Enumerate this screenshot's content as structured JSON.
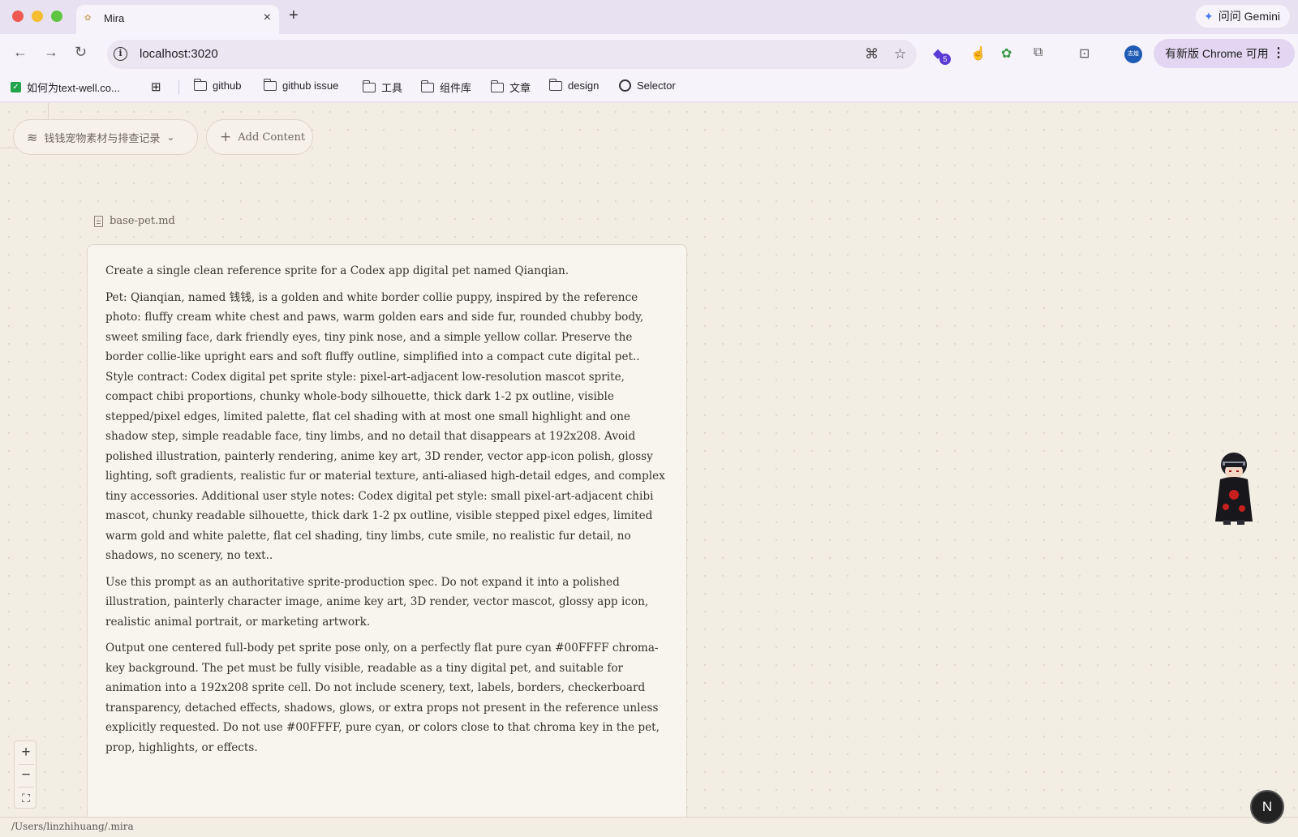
{
  "browser": {
    "tab": {
      "title": "Mira"
    },
    "gemini_label": "问问 Gemini",
    "url": "localhost:3020",
    "update_label": "有新版 Chrome 可用",
    "avatar_text": "志煌",
    "extension_badge": "5"
  },
  "bookmarks": [
    {
      "label": "如何为text-well.co..."
    },
    {
      "label": "github"
    },
    {
      "label": "github issue"
    },
    {
      "label": "工具"
    },
    {
      "label": "组件库"
    },
    {
      "label": "文章"
    },
    {
      "label": "design"
    },
    {
      "label": "Selector"
    }
  ],
  "canvas": {
    "workspace_label": "钱钱宠物素材与排查记录",
    "add_content_label": "Add Content",
    "file_name": "base-pet.md",
    "paragraphs": [
      "Create a single clean reference sprite for a Codex app digital pet named Qianqian.",
      "Pet: Qianqian, named 钱钱, is a golden and white border collie puppy, inspired by the reference photo: fluffy cream white chest and paws, warm golden ears and side fur, rounded chubby body, sweet smiling face, dark friendly eyes, tiny pink nose, and a simple yellow collar. Preserve the border collie-like upright ears and soft fluffy outline, simplified into a compact cute digital pet.. Style contract: Codex digital pet sprite style: pixel-art-adjacent low-resolution mascot sprite, compact chibi proportions, chunky whole-body silhouette, thick dark 1-2 px outline, visible stepped/pixel edges, limited palette, flat cel shading with at most one small highlight and one shadow step, simple readable face, tiny limbs, and no detail that disappears at 192x208. Avoid polished illustration, painterly rendering, anime key art, 3D render, vector app-icon polish, glossy lighting, soft gradients, realistic fur or material texture, anti-aliased high-detail edges, and complex tiny accessories. Additional user style notes: Codex digital pet style: small pixel-art-adjacent chibi mascot, chunky readable silhouette, thick dark 1-2 px outline, visible stepped pixel edges, limited warm gold and white palette, flat cel shading, tiny limbs, cute smile, no realistic fur detail, no shadows, no scenery, no text..",
      "Use this prompt as an authoritative sprite-production spec. Do not expand it into a polished illustration, painterly character image, anime key art, 3D render, vector mascot, glossy app icon, realistic animal portrait, or marketing artwork.",
      "Output one centered full-body pet sprite pose only, on a perfectly flat pure cyan #00FFFF chroma-key background. The pet must be fully visible, readable as a tiny digital pet, and suitable for animation into a 192x208 sprite cell. Do not include scenery, text, labels, borders, checkerboard transparency, detached effects, shadows, glows, or extra props not present in the reference unless explicitly requested. Do not use #00FFFF, pure cyan, or colors close to that chroma key in the pet, prop, highlights, or effects."
    ],
    "zoom_in": "+",
    "zoom_out": "−",
    "fit": "⛶",
    "status_path": "/Users/linzhihuang/.mira",
    "n_label": "N"
  },
  "colors": {
    "canvas_bg": "#f2eee4",
    "card_bg": "#f8f5ee",
    "chrome_bg": "#f7f3fb",
    "accent": "#5b3bd5"
  }
}
